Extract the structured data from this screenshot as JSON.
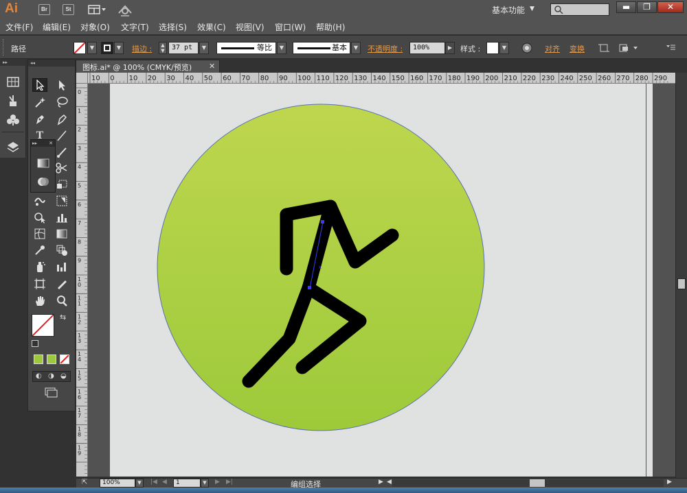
{
  "app": {
    "logo": "Ai",
    "bridge_label": "Br",
    "stock_label": "St",
    "workspace": "基本功能"
  },
  "menu": [
    "文件(F)",
    "编辑(E)",
    "对象(O)",
    "文字(T)",
    "选择(S)",
    "效果(C)",
    "视图(V)",
    "窗口(W)",
    "帮助(H)"
  ],
  "control": {
    "selection_type": "路径",
    "stroke_label": "描边 :",
    "stroke_weight": "37 pt",
    "profile_label": "等比",
    "brush_label": "基本",
    "opacity_label": "不透明度 :",
    "opacity_value": "100%",
    "style_label": "样式 :",
    "align_label": "对齐",
    "transform_label": "变换"
  },
  "document": {
    "tab_title": "图标.ai* @ 100% (CMYK/预览)"
  },
  "rulers": {
    "horizontal": [
      "10",
      "0",
      "10",
      "20",
      "30",
      "40",
      "50",
      "60",
      "70",
      "80",
      "90",
      "100",
      "110",
      "120",
      "130",
      "140",
      "150",
      "160",
      "170",
      "180",
      "190",
      "200",
      "210",
      "220",
      "230",
      "240",
      "250",
      "260",
      "270",
      "280",
      "290"
    ],
    "vertical": [
      "0",
      "1",
      "2",
      "3",
      "4",
      "5",
      "6",
      "7",
      "8",
      "9",
      "10",
      "11",
      "12",
      "13",
      "14",
      "15",
      "16",
      "17",
      "18",
      "19"
    ]
  },
  "status": {
    "zoom": "100%",
    "artboard": "1",
    "text": "编组选择"
  },
  "colors": {
    "circle_top": "#bed64e",
    "circle_bottom": "#9dca3a",
    "figure": "#000000",
    "selection": "#3a3aff",
    "artboard": "#e0e2e1",
    "swatch_green": "#9dc83c"
  },
  "icons": {
    "dock": [
      "grid-icon",
      "brush-icon",
      "club-icon",
      "layers-icon"
    ],
    "tools": [
      "selection-tool-icon",
      "direct-selection-tool-icon",
      "magic-wand-icon",
      "lasso-icon",
      "pen-icon",
      "curvature-icon",
      "type-icon",
      "line-icon",
      "rectangle-icon",
      "paintbrush-icon",
      "blob-brush-icon",
      "scissors-icon",
      "rotate-icon",
      "free-transform-icon",
      "warp-icon",
      "perspective-icon",
      "shape-builder-icon",
      "graph-icon",
      "mesh-icon",
      "gradient-icon",
      "eyedropper-icon",
      "blend-icon",
      "symbol-sprayer-icon",
      "column-graph-icon",
      "artboard-icon",
      "slice-icon",
      "hand-icon",
      "zoom-icon"
    ]
  }
}
